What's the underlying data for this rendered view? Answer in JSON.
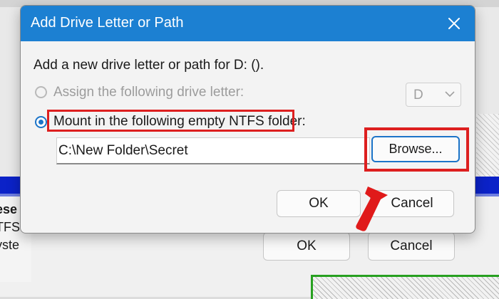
{
  "dialog": {
    "title": "Add Drive Letter or Path",
    "instruction": "Add a new drive letter or path for D: ().",
    "option_assign_label": "Assign the following drive letter:",
    "option_mount_label": "Mount in the following empty NTFS folder:",
    "drive_letter_value": "D",
    "path_value": "C:\\New Folder\\Secret",
    "browse_label": "Browse...",
    "ok_label": "OK",
    "cancel_label": "Cancel",
    "selected_option": "mount"
  },
  "background": {
    "left_text_1": "ese",
    "left_text_2": "TFS",
    "left_text_3": "yste",
    "ok_label": "OK",
    "cancel_label": "Cancel"
  },
  "colors": {
    "titlebar": "#1c80d2",
    "highlight": "#dd1f1f",
    "accent": "#1c74c8"
  },
  "icons": {
    "close": "close-icon",
    "dropdown": "chevron-down-icon",
    "arrow": "annotation-arrow"
  }
}
